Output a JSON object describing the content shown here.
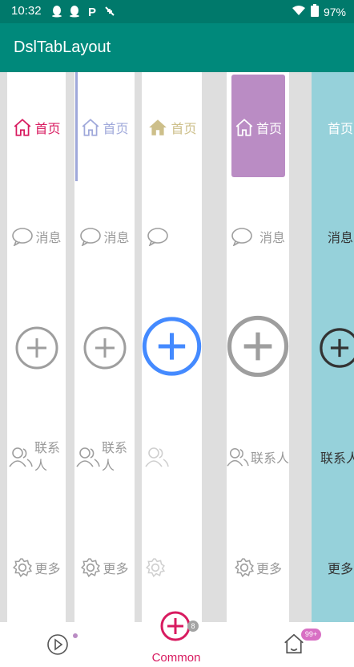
{
  "status": {
    "time": "10:32",
    "battery": "97%"
  },
  "app": {
    "title": "DslTabLayout"
  },
  "columns": [
    {
      "home": "首页",
      "message": "消息",
      "contacts": "联系人",
      "more": "更多"
    },
    {
      "home": "首页",
      "message": "消息",
      "contacts": "联系人",
      "more": "更多"
    },
    {
      "home": "首页"
    },
    {
      "home": "首页",
      "message": "消息",
      "contacts": "联系人",
      "more": "更多"
    },
    {
      "home": "首页",
      "message": "消息",
      "contacts": "联系人",
      "more": "更多"
    }
  ],
  "bottom": {
    "common_label": "Common",
    "common_badge": "8",
    "home_badge": "99+"
  },
  "colors": {
    "accent_pink": "#d81b60",
    "accent_blue": "#448aff",
    "gray": "#9e9e9e",
    "teal": "#00897b",
    "purple": "#ba8cc4",
    "cyan": "#96d1da"
  },
  "icons": [
    "home-icon",
    "message-icon",
    "add-icon",
    "contacts-icon",
    "settings-icon",
    "play-icon"
  ]
}
